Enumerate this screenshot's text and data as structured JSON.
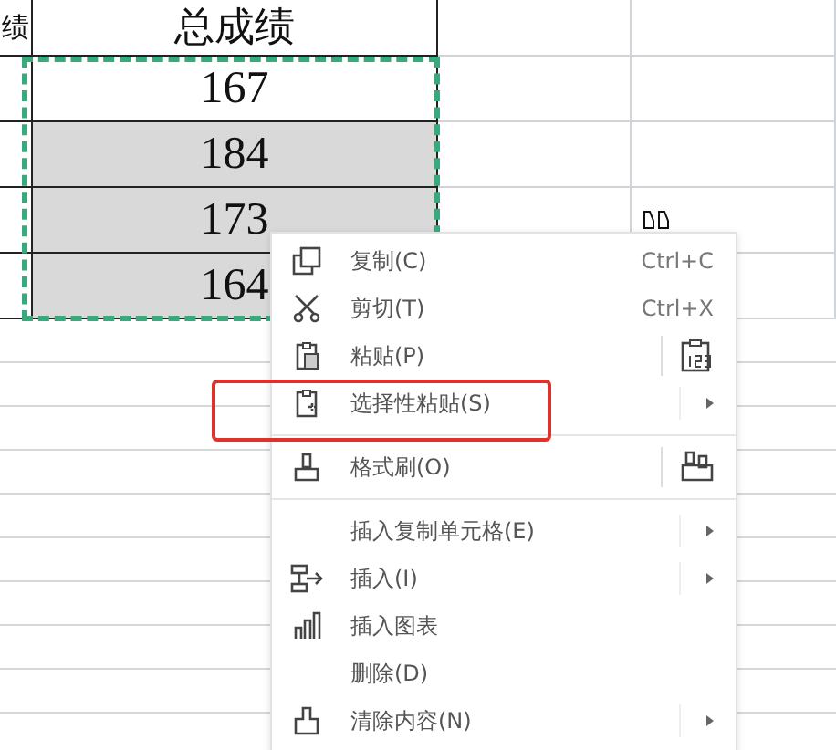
{
  "sheet": {
    "left_header": "绩",
    "header": "总成绩",
    "cells": [
      {
        "value": "167",
        "selected": false
      },
      {
        "value": "184",
        "selected": true
      },
      {
        "value": "173",
        "selected": true
      },
      {
        "value": "164",
        "selected": true
      }
    ]
  },
  "context_menu": {
    "items": [
      {
        "kind": "item",
        "label": "复制(C)",
        "shortcut": "Ctrl+C",
        "submenu": false,
        "side_button": false
      },
      {
        "kind": "item",
        "label": "剪切(T)",
        "shortcut": "Ctrl+X",
        "submenu": false,
        "side_button": false
      },
      {
        "kind": "item",
        "label": "粘贴(P)",
        "submenu": false,
        "side_button": true
      },
      {
        "kind": "item",
        "label": "选择性粘贴(S)",
        "submenu": true,
        "side_button": false,
        "highlighted": true
      },
      {
        "kind": "divider"
      },
      {
        "kind": "item",
        "label": "格式刷(O)",
        "submenu": false,
        "side_button": true
      },
      {
        "kind": "divider"
      },
      {
        "kind": "item",
        "label": "插入复制单元格(E)",
        "submenu": true,
        "side_button": false
      },
      {
        "kind": "item",
        "label": "插入(I)",
        "submenu": true,
        "side_button": false
      },
      {
        "kind": "item",
        "label": "插入图表",
        "submenu": false,
        "side_button": false
      },
      {
        "kind": "item",
        "label": "删除(D)",
        "submenu": false,
        "side_button": false
      },
      {
        "kind": "item",
        "label": "清除内容(N)",
        "submenu": true,
        "side_button": false
      }
    ]
  }
}
